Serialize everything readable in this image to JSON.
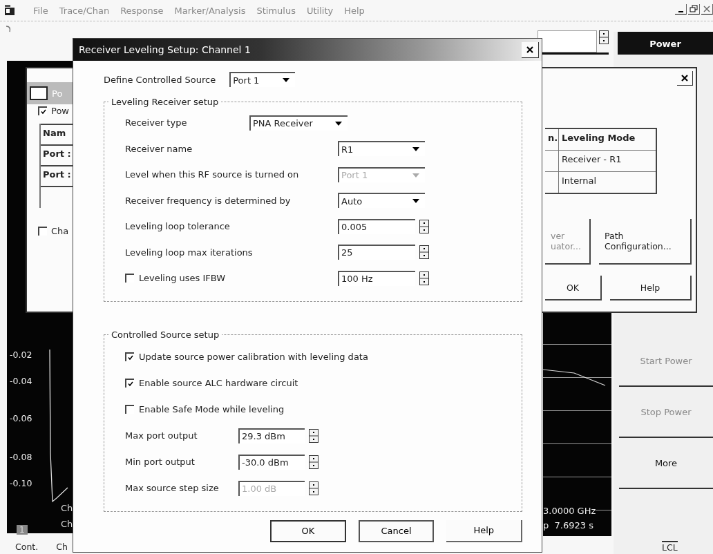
{
  "menu_bar": {
    "items": [
      "File",
      "Trace/Chan",
      "Response",
      "Marker/Analysis",
      "Stimulus",
      "Utility",
      "Help"
    ]
  },
  "softkey_panel": {
    "title": "Power",
    "keys": [
      "Start Power",
      "Stop Power",
      "More"
    ],
    "status": "LCL"
  },
  "left_chart": {
    "y_labels": [
      "-0.02",
      "-0.04",
      "-0.06",
      "-0.08",
      "-0.10"
    ],
    "channel_badge": "1",
    "footer_lines": [
      "Ch",
      "Ch"
    ]
  },
  "right_chart": {
    "footer_lines": [
      "3.0000 GHz",
      "p  7.6923 s"
    ]
  },
  "status_bar": {
    "items": [
      "Cont.",
      "Ch"
    ]
  },
  "power_window": {
    "title": "Po",
    "checkboxes": [
      {
        "label": "Pow",
        "checked": true
      },
      {
        "label": "Cha",
        "checked": false
      }
    ],
    "name_column": [
      "Nam",
      "Port :",
      "Port :"
    ],
    "mode_table": {
      "columns": [
        "n.",
        "Leveling Mode"
      ],
      "rows": [
        "Receiver - R1",
        "Internal"
      ]
    },
    "buttons": [
      {
        "lines": [
          "ver",
          "uator..."
        ],
        "disabled": true
      },
      {
        "lines": [
          "Path",
          "Configuration..."
        ],
        "disabled": false
      },
      {
        "lines": [
          "OK"
        ],
        "disabled": false
      },
      {
        "lines": [
          "Help"
        ],
        "disabled": false
      }
    ]
  },
  "dialog": {
    "title": "Receiver Leveling Setup: Channel 1",
    "source": {
      "label": "Define Controlled Source",
      "value": "Port 1"
    },
    "receiver_group": {
      "title": "Leveling Receiver setup",
      "rows": [
        {
          "kind": "dropdown",
          "label": "Receiver type",
          "value": "PNA Receiver",
          "disabled": false
        },
        {
          "kind": "dropdown",
          "label": "Receiver name",
          "value": "R1",
          "disabled": false
        },
        {
          "kind": "dropdown",
          "label": "Level when this RF source is turned on",
          "value": "Port 1",
          "disabled": true
        },
        {
          "kind": "dropdown",
          "label": "Receiver frequency is determined by",
          "value": "Auto",
          "disabled": false
        },
        {
          "kind": "spin",
          "label": "Leveling loop tolerance",
          "value": "0.005",
          "disabled": false
        },
        {
          "kind": "spin",
          "label": "Leveling loop max iterations",
          "value": "25",
          "disabled": false
        },
        {
          "kind": "check_spin",
          "label": "Leveling uses IFBW",
          "checked": false,
          "value": "100 Hz",
          "disabled": false
        }
      ]
    },
    "source_group": {
      "title": "Controlled Source setup",
      "checks": [
        {
          "label": "Update source power calibration with leveling data",
          "checked": true
        },
        {
          "label": "Enable source ALC hardware circuit",
          "checked": true
        },
        {
          "label": "Enable Safe Mode while leveling",
          "checked": false
        }
      ],
      "fields": [
        {
          "label": "Max port output",
          "value": "29.3 dBm",
          "disabled": false
        },
        {
          "label": "Min port output",
          "value": "-30.0 dBm",
          "disabled": false
        },
        {
          "label": "Max source step size",
          "value": "1.00 dB",
          "disabled": true
        }
      ]
    },
    "buttons": [
      "OK",
      "Cancel",
      "Help"
    ]
  }
}
